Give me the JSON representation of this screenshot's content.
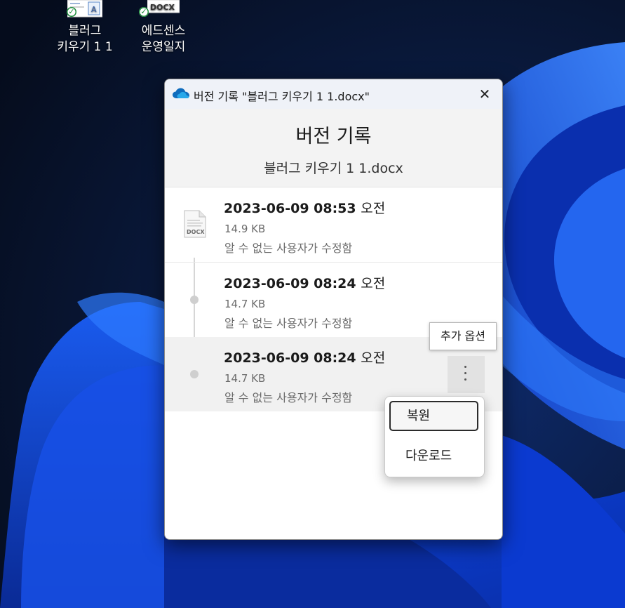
{
  "desktop": {
    "icons": [
      {
        "label": "블러그\n키우기 1 1"
      },
      {
        "label": "에드센스\n운영일지",
        "thumb_text": "DOCX"
      }
    ]
  },
  "dialog": {
    "title": "버전 기록 \"블러그 키우기 1 1.docx\"",
    "close_glyph": "✕",
    "heading": "버전 기록",
    "filename": "블러그 키우기 1 1.docx",
    "file_icon_text": "DOCX",
    "versions": [
      {
        "date": "2023-06-09 08:53",
        "ampm": "오전",
        "size": "14.9 KB",
        "author": "알 수 없는 사용자가 수정함"
      },
      {
        "date": "2023-06-09 08:24",
        "ampm": "오전",
        "size": "14.7 KB",
        "author": "알 수 없는 사용자가 수정함"
      },
      {
        "date": "2023-06-09 08:24",
        "ampm": "오전",
        "size": "14.7 KB",
        "author": "알 수 없는 사용자가 수정함"
      }
    ],
    "more_options_tooltip": "추가 옵션",
    "context_menu": {
      "restore": "복원",
      "download": "다운로드"
    }
  },
  "colors": {
    "onedrive_blue": "#0f6cbd",
    "sync_green": "#1b8a3a",
    "selected_row": "#f1f1f1"
  }
}
